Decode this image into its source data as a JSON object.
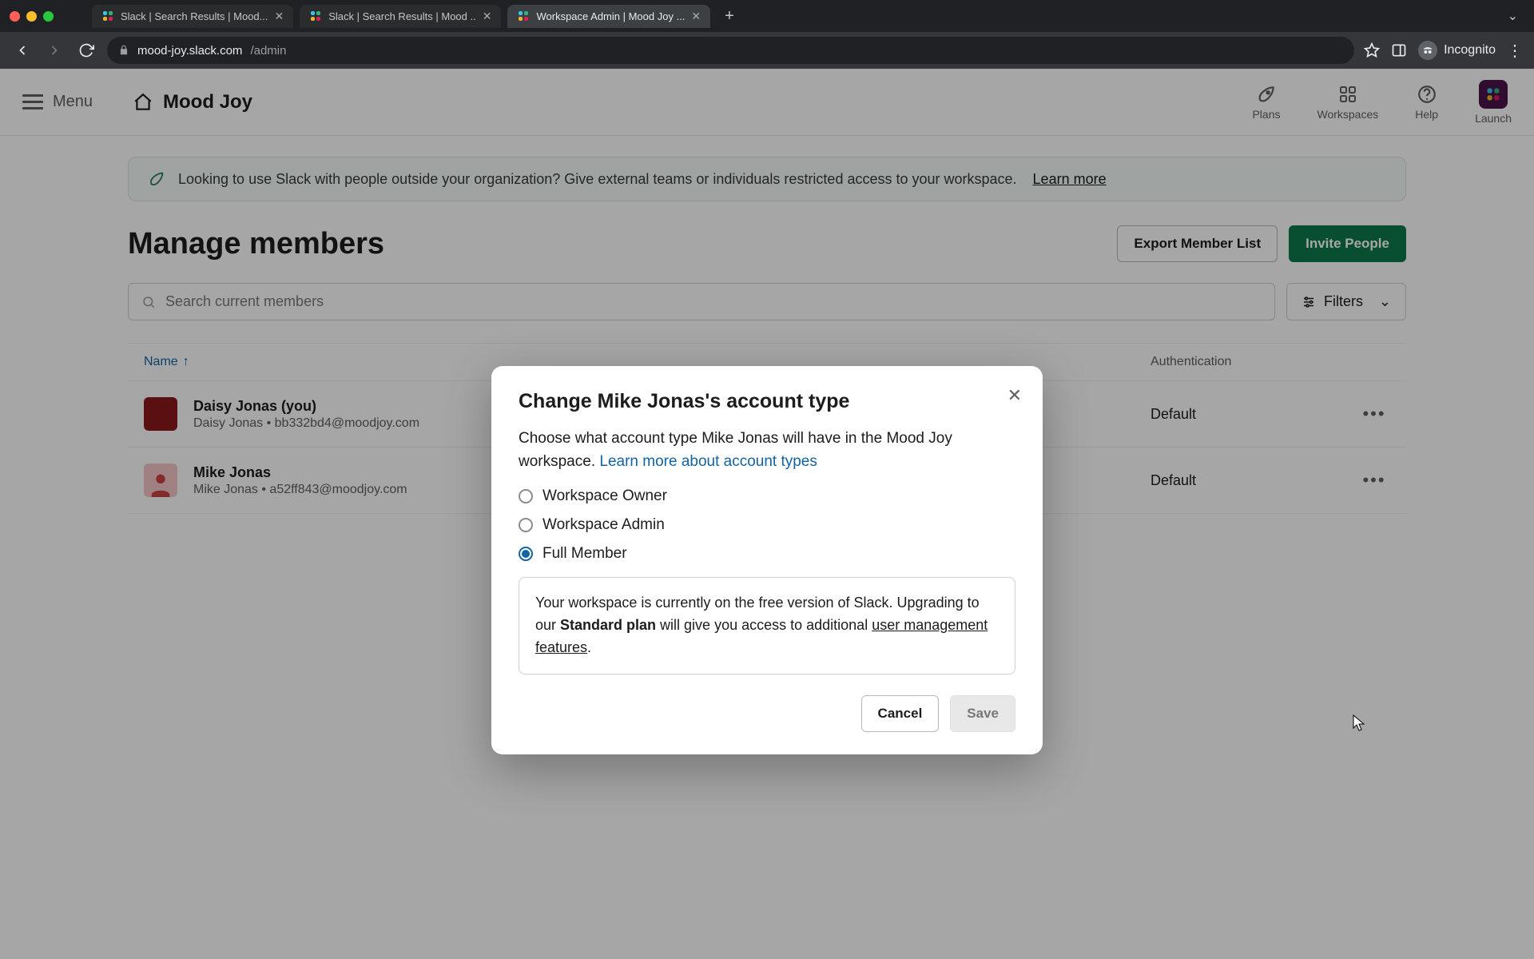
{
  "browser": {
    "tabs": [
      {
        "title": "Slack | Search Results | Mood...",
        "active": false
      },
      {
        "title": "Slack | Search Results | Mood ..",
        "active": false
      },
      {
        "title": "Workspace Admin | Mood Joy ...",
        "active": true
      }
    ],
    "url_host": "mood-joy.slack.com",
    "url_path": "/admin",
    "incognito_label": "Incognito"
  },
  "slack_header": {
    "menu_label": "Menu",
    "workspace_name": "Mood Joy",
    "actions": {
      "plans": "Plans",
      "workspaces": "Workspaces",
      "help": "Help",
      "launch": "Launch"
    }
  },
  "banner": {
    "text": "Looking to use Slack with people outside your organization? Give external teams or individuals restricted access to your workspace.",
    "link_text": "Learn more"
  },
  "page_title": "Manage members",
  "buttons": {
    "export": "Export Member List",
    "invite": "Invite People",
    "filters": "Filters"
  },
  "search_placeholder": "Search current members",
  "table": {
    "col_name": "Name",
    "col_auth": "Authentication",
    "rows": [
      {
        "name": "Daisy Jonas (you)",
        "sub": "Daisy Jonas • bb332bd4@moodjoy.com",
        "auth": "Default",
        "avatar": "red"
      },
      {
        "name": "Mike Jonas",
        "sub": "Mike Jonas • a52ff843@moodjoy.com",
        "auth": "Default",
        "avatar": "person"
      }
    ]
  },
  "modal": {
    "title": "Change Mike Jonas's account type",
    "desc_a": "Choose what account type Mike Jonas will have in the Mood Joy workspace. ",
    "desc_link": "Learn more about account types",
    "options": {
      "owner": "Workspace Owner",
      "admin": "Workspace Admin",
      "member": "Full Member"
    },
    "selected": "member",
    "info_a": "Your workspace is currently on the free version of Slack. Upgrading to our ",
    "info_bold": "Standard plan",
    "info_b": " will give you access to additional ",
    "info_link": "user management features",
    "info_c": ".",
    "cancel": "Cancel",
    "save": "Save"
  }
}
